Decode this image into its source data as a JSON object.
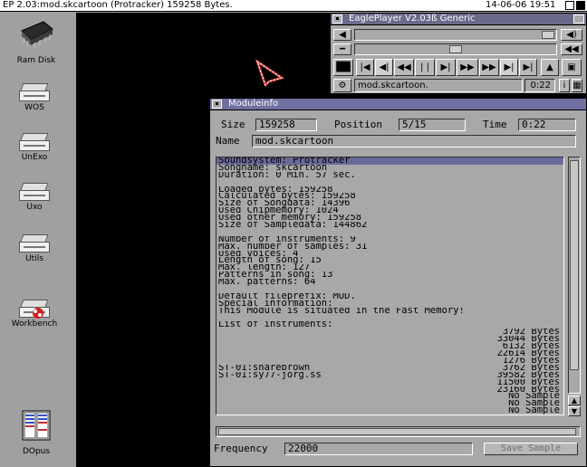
{
  "screen": {
    "title": "EP 2.03:mod.skcartoon (Protracker) 159258 Bytes.",
    "clock": "14-06-06 19:51"
  },
  "desktop_icons": [
    {
      "label": "Ram Disk",
      "icon": "ram-disk-icon"
    },
    {
      "label": "WOS",
      "icon": "disk-icon"
    },
    {
      "label": "UnExo",
      "icon": "disk-icon"
    },
    {
      "label": "Uxo",
      "icon": "disk-icon"
    },
    {
      "label": "Utils",
      "icon": "disk-icon"
    },
    {
      "label": "Workbench",
      "icon": "workbench-disk-icon"
    },
    {
      "label": "DOpus",
      "icon": "dopus-icon"
    }
  ],
  "player": {
    "title": "EaglePlayer V2.03ß Generic",
    "module_name": "mod.skcartoon.",
    "time": "0:22",
    "volume_level": 1.0,
    "position_level": 0.5,
    "buttons": [
      "volume-icon",
      "prev-module",
      "first-pattern",
      "rewind",
      "pause",
      "play",
      "fast-forward",
      "next-pattern",
      "next-module",
      "stop",
      "eject",
      "save"
    ]
  },
  "moduleinfo": {
    "title": "Moduleinfo",
    "size_label": "Size",
    "size_value": "159258",
    "position_label": "Position",
    "position_value": "5/15",
    "time_label": "Time",
    "time_value": "0:22",
    "name_label": "Name",
    "name_value": "mod.skcartoon",
    "lines": [
      {
        "text": "Soundsystem: Protracker",
        "right": "",
        "selected": true
      },
      {
        "text": "Songname: skcartoon",
        "right": ""
      },
      {
        "text": "Duration: 0 Min. 57 sec.",
        "right": ""
      },
      {
        "text": "",
        "right": ""
      },
      {
        "text": "Loaded bytes: 159258",
        "right": ""
      },
      {
        "text": "Calculated bytes: 159258",
        "right": ""
      },
      {
        "text": "Size of Songdata: 14396",
        "right": ""
      },
      {
        "text": "Used Chipmemory: 1024",
        "right": ""
      },
      {
        "text": "Used other memory: 159258",
        "right": ""
      },
      {
        "text": "Size of Sampledata: 144862",
        "right": ""
      },
      {
        "text": "",
        "right": ""
      },
      {
        "text": "Number of instruments: 9",
        "right": ""
      },
      {
        "text": "Max. number of samples: 31",
        "right": ""
      },
      {
        "text": "Used voices: 4",
        "right": ""
      },
      {
        "text": "Length of song: 15",
        "right": ""
      },
      {
        "text": "Max. length: 127",
        "right": ""
      },
      {
        "text": "Patterns in song: 13",
        "right": ""
      },
      {
        "text": "Max. patterns: 64",
        "right": ""
      },
      {
        "text": "",
        "right": ""
      },
      {
        "text": "Default fileprefix: MOD.",
        "right": ""
      },
      {
        "text": "Special information:",
        "right": ""
      },
      {
        "text": "This Module is situated in the Fast Memory!",
        "right": ""
      },
      {
        "text": "",
        "right": ""
      },
      {
        "text": "List of instruments:",
        "right": ""
      },
      {
        "text": "",
        "right": "3792 Bytes"
      },
      {
        "text": "",
        "right": "33044 Bytes"
      },
      {
        "text": "",
        "right": "6132 Bytes"
      },
      {
        "text": "",
        "right": "22614 Bytes"
      },
      {
        "text": "",
        "right": "1276 Bytes"
      },
      {
        "text": "ST-01:snarebrown",
        "right": "3762 Bytes"
      },
      {
        "text": "ST-01:sy77-jorg.ss",
        "right": "39582 Bytes"
      },
      {
        "text": "",
        "right": "11500 Bytes"
      },
      {
        "text": "",
        "right": "23160 Bytes"
      },
      {
        "text": "",
        "right": "No Sample"
      },
      {
        "text": "",
        "right": "No Sample"
      },
      {
        "text": "",
        "right": "No Sample"
      }
    ],
    "frequency_label": "Frequency",
    "frequency_value": "22000",
    "save_button": "Save Sample"
  }
}
